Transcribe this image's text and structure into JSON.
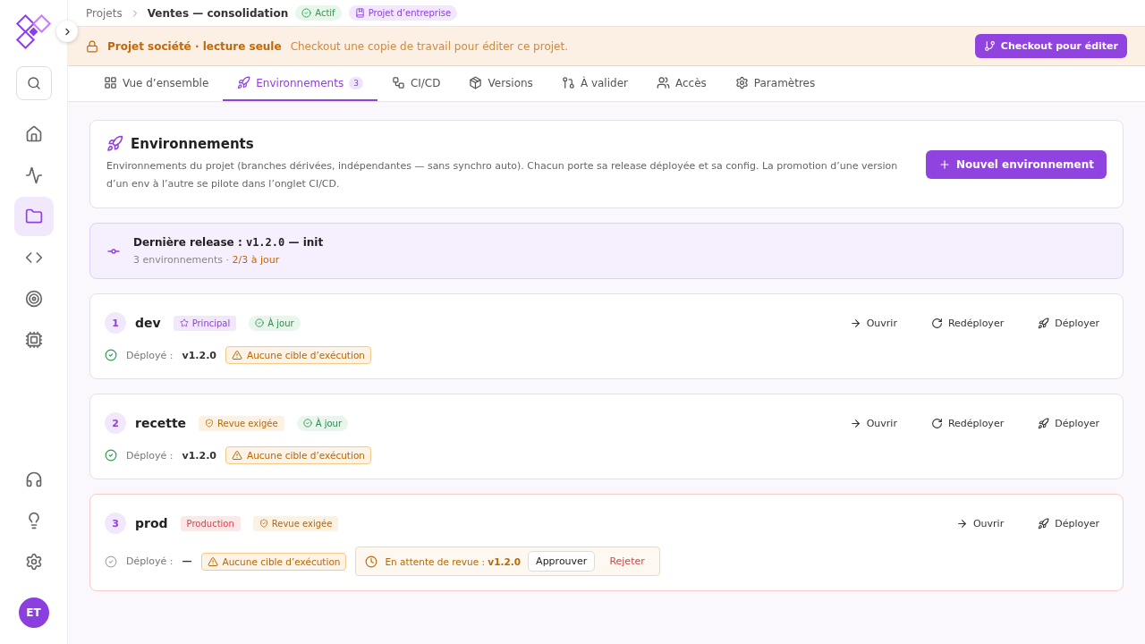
{
  "sidebar": {
    "items": [
      {
        "kind": "home",
        "selected": false
      },
      {
        "kind": "activity",
        "selected": false
      },
      {
        "kind": "folder",
        "selected": true
      },
      {
        "kind": "code",
        "selected": false
      },
      {
        "kind": "target",
        "selected": false
      },
      {
        "kind": "chip",
        "selected": false
      }
    ],
    "bottom": [
      {
        "kind": "support"
      },
      {
        "kind": "idea"
      },
      {
        "kind": "settings"
      }
    ],
    "avatar": "ET"
  },
  "breadcrumb": {
    "parent": "Projets",
    "current": "Ventes — consolidation",
    "badges": [
      {
        "kind": "status",
        "label": "Actif"
      },
      {
        "kind": "enterprise",
        "label": "Projet d’entreprise"
      }
    ]
  },
  "banner": {
    "title": "Projet société · lecture seule",
    "message": "Checkout une copie de travail pour éditer ce projet.",
    "button": "Checkout pour éditer"
  },
  "tabs": [
    {
      "label": "Vue d’ensemble",
      "selected": false
    },
    {
      "label": "Environnements",
      "count": "3",
      "selected": true
    },
    {
      "label": "CI/CD",
      "selected": false
    },
    {
      "label": "Versions",
      "selected": false
    },
    {
      "label": "À valider",
      "selected": false
    },
    {
      "label": "Accès",
      "selected": false
    },
    {
      "label": "Paramètres",
      "selected": false
    }
  ],
  "header": {
    "title": "Environnements",
    "description": "Environnements du projet (branches dérivées, indépendantes — sans synchro auto). Chacun porte sa release déployée et sa config. La promotion d’une version d’un env à l’autre se pilote dans l’onglet CI/CD.",
    "button": "Nouvel environnement"
  },
  "release": {
    "label": "Dernière release :",
    "version": "v1.2.0",
    "suffix": "— init",
    "count": "3 environnements",
    "separator": "·",
    "sync": "2/3 à jour"
  },
  "environments": [
    {
      "index": "1",
      "name": "dev",
      "kind": "standard",
      "tags": [
        {
          "kind": "principal",
          "label": "Principal"
        },
        {
          "kind": "uptodate",
          "label": "À jour"
        }
      ],
      "deployed": true,
      "deployed_label": "Déployé :",
      "version": "v1.2.0",
      "warning": "Aucune cible d’exécution",
      "actions": [
        {
          "kind": "open",
          "label": "Ouvrir"
        },
        {
          "kind": "redeploy",
          "label": "Redéployer"
        },
        {
          "kind": "deploy",
          "label": "Déployer"
        }
      ]
    },
    {
      "index": "2",
      "name": "recette",
      "kind": "standard",
      "tags": [
        {
          "kind": "review",
          "label": "Revue exigée"
        },
        {
          "kind": "uptodate",
          "label": "À jour"
        }
      ],
      "deployed": true,
      "deployed_label": "Déployé :",
      "version": "v1.2.0",
      "warning": "Aucune cible d’exécution",
      "actions": [
        {
          "kind": "open",
          "label": "Ouvrir"
        },
        {
          "kind": "redeploy",
          "label": "Redéployer"
        },
        {
          "kind": "deploy",
          "label": "Déployer"
        }
      ]
    },
    {
      "index": "3",
      "name": "prod",
      "kind": "production",
      "tags": [
        {
          "kind": "production",
          "label": "Production"
        },
        {
          "kind": "review",
          "label": "Revue exigée"
        }
      ],
      "deployed": false,
      "deployed_label": "Déployé :",
      "version": "—",
      "warning": "Aucune cible d’exécution",
      "pending": {
        "label": "En attente de revue :",
        "version": "v1.2.0",
        "approve": "Approuver",
        "reject": "Rejeter"
      },
      "actions": [
        {
          "kind": "open",
          "label": "Ouvrir"
        },
        {
          "kind": "deploy",
          "label": "Déployer"
        }
      ]
    }
  ]
}
